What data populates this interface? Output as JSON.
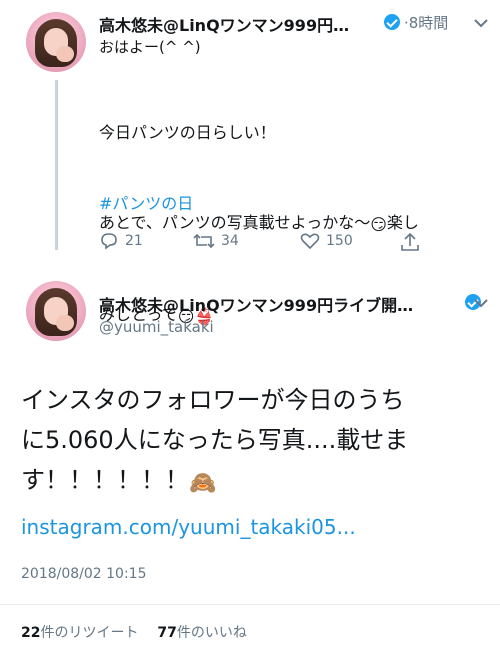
{
  "tweet1": {
    "display_name": "高木悠未@LinQワンマン999円…",
    "time": "·8時間",
    "greeting": "おはよー(^ ^)",
    "line1": "今日パンツの日らしい！",
    "line2a": "あとで、パンツの写真載せよっかな〜",
    "line2b": "楽し",
    "line3a": "みしとって",
    "hashtag": "#パンツの日",
    "reply_count": "21",
    "retweet_count": "34",
    "like_count": "150"
  },
  "tweet2": {
    "display_name": "高木悠未@LinQワンマン999円ライブ開…",
    "handle": "@yuumi_takaki",
    "text_line1": "インスタのフォロワーが今日のうち",
    "text_line2": "に5.060人になったら写真....載せま",
    "text_line3": "す！！！！！！",
    "link": "instagram.com/yuumi_takaki05...",
    "timestamp": "2018/08/02 10:15",
    "retweets_num": "22",
    "retweets_label": "件のリツイート",
    "likes_num": "77",
    "likes_label": "件のいいね"
  },
  "icons": {
    "verified": "verified-badge-icon",
    "chevron": "chevron-down-icon",
    "reply": "reply-icon",
    "retweet": "retweet-icon",
    "like": "heart-icon",
    "share": "share-icon"
  },
  "colors": {
    "link_blue": "#1b95e0",
    "verified_blue": "#1da1f2",
    "muted": "#657786",
    "text": "#14171a"
  }
}
